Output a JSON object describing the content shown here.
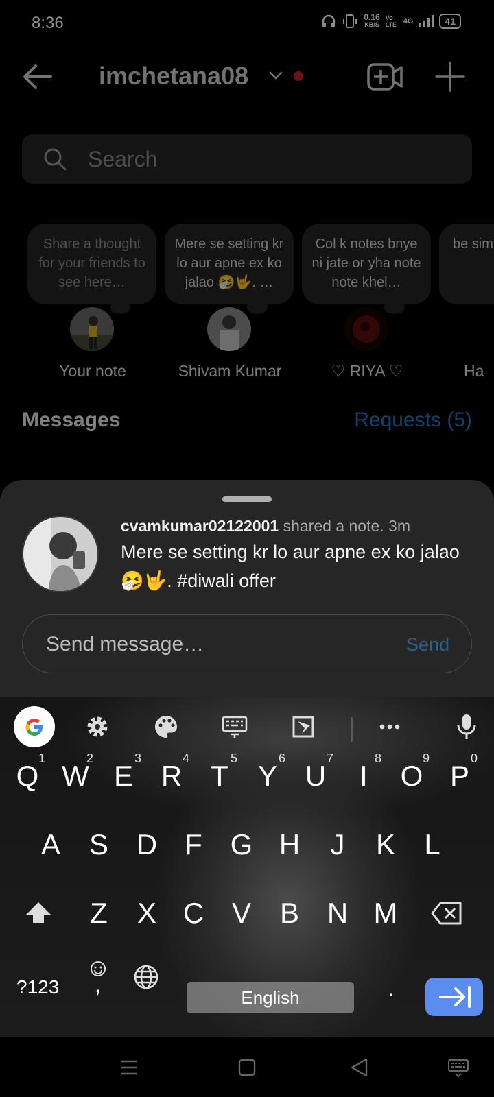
{
  "status": {
    "time": "8:36",
    "net_speed_top": "0.16",
    "net_speed_unit": "KB/S",
    "volte": "Vo LTE",
    "network": "4G",
    "battery": "41"
  },
  "header": {
    "username": "imchetana08"
  },
  "search": {
    "placeholder": "Search"
  },
  "notes": [
    {
      "text": "Share a thought for your friends to see here…",
      "name": "Your note",
      "placeholder": true
    },
    {
      "text": "Mere se setting kr lo aur apne ex ko jalao 🤧🤟. …",
      "name": "Shivam Kumar",
      "placeholder": false
    },
    {
      "text": "Col k notes bnye ni jate or yha note note khel…",
      "name": "♡ RIYA ♡",
      "placeholder": false
    },
    {
      "text": "be simp",
      "name": "Ha",
      "placeholder": false
    }
  ],
  "messages": {
    "title": "Messages",
    "requests": "Requests (5)"
  },
  "sheet": {
    "user": "cvamkumar02122001",
    "action": "shared a note. 3m",
    "text": "Mere se setting kr lo aur apne ex ko jalao 🤧🤟. #diwali offer",
    "input_placeholder": "Send message…",
    "send_label": "Send"
  },
  "keyboard": {
    "row1": [
      {
        "k": "Q",
        "n": "1"
      },
      {
        "k": "W",
        "n": "2"
      },
      {
        "k": "E",
        "n": "3"
      },
      {
        "k": "R",
        "n": "4"
      },
      {
        "k": "T",
        "n": "5"
      },
      {
        "k": "Y",
        "n": "6"
      },
      {
        "k": "U",
        "n": "7"
      },
      {
        "k": "I",
        "n": "8"
      },
      {
        "k": "O",
        "n": "9"
      },
      {
        "k": "P",
        "n": "0"
      }
    ],
    "row2": [
      "A",
      "S",
      "D",
      "F",
      "G",
      "H",
      "J",
      "K",
      "L"
    ],
    "row3": [
      "Z",
      "X",
      "C",
      "V",
      "B",
      "N",
      "M"
    ],
    "symbols": "?123",
    "emoji_comma": ",",
    "space": "English",
    "period": ".",
    "enter_color": "#5b8def"
  },
  "colors": {
    "accent": "#1e78c8",
    "unread_dot": "#c1262f"
  }
}
